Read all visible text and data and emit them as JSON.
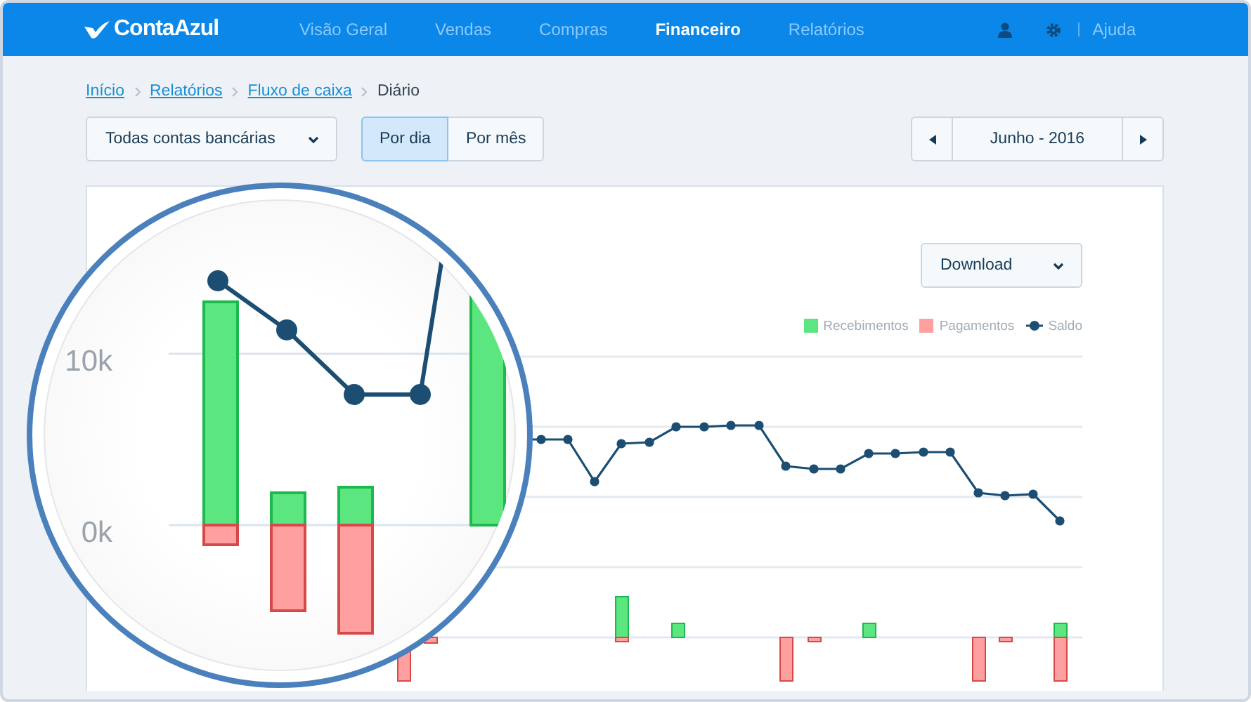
{
  "header": {
    "logo": "ContaAzul",
    "nav": [
      {
        "label": "Visão Geral",
        "selected": false
      },
      {
        "label": "Vendas",
        "selected": false
      },
      {
        "label": "Compras",
        "selected": false
      },
      {
        "label": "Financeiro",
        "selected": true
      },
      {
        "label": "Relatórios",
        "selected": false
      }
    ],
    "help": "Ajuda"
  },
  "breadcrumb": {
    "links": [
      "Início",
      "Relatórios",
      "Fluxo de caixa"
    ],
    "current": "Diário"
  },
  "toolbar": {
    "account_select": "Todas contas bancárias",
    "period_toggle": [
      {
        "label": "Por dia",
        "selected": true
      },
      {
        "label": "Por mês",
        "selected": false
      }
    ],
    "month_label": "Junho - 2016"
  },
  "chart": {
    "download": "Download",
    "legend": [
      {
        "kind": "bar",
        "label": "Recebimentos",
        "color": "#5ce67f"
      },
      {
        "kind": "bar",
        "label": "Pagamentos",
        "color": "#ffa0a0"
      },
      {
        "kind": "line",
        "label": "Saldo",
        "color": "#1b4e72"
      }
    ],
    "magnifier_ticks": [
      "10k",
      "0k"
    ]
  }
}
